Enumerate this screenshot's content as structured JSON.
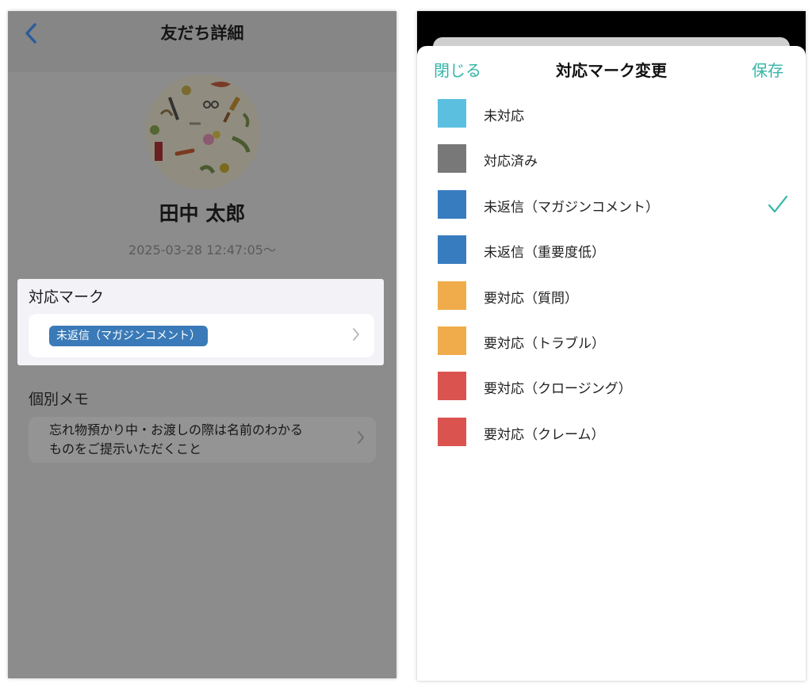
{
  "detail_screen": {
    "title": "友だち詳細",
    "user": {
      "name": "田中 太郎",
      "follow_date": "2025-03-28 12:47:05〜"
    },
    "mark_section": {
      "label": "対応マーク",
      "current_mark": "未返信（マガジンコメント）",
      "current_mark_color": "#3a7ab8"
    },
    "memo_section": {
      "label": "個別メモ",
      "text_line1": "忘れ物預かり中・お渡しの際は名前のわかる",
      "text_line2": "ものをご提示いただくこと"
    },
    "icons": {
      "back": "chevron-left-icon",
      "row_arrow": "chevron-right-icon"
    }
  },
  "mark_sheet": {
    "title": "対応マーク変更",
    "close_label": "閉じる",
    "save_label": "保存",
    "accent_color": "#35b6a8",
    "options": [
      {
        "label": "未対応",
        "color": "#5bbfdf",
        "selected": false
      },
      {
        "label": "対応済み",
        "color": "#787878",
        "selected": false
      },
      {
        "label": "未返信（マガジンコメント）",
        "color": "#377cbf",
        "selected": true
      },
      {
        "label": "未返信（重要度低）",
        "color": "#377cbf",
        "selected": false
      },
      {
        "label": "要対応（質問）",
        "color": "#f0ac4a",
        "selected": false
      },
      {
        "label": "要対応（トラブル）",
        "color": "#f0ac4a",
        "selected": false
      },
      {
        "label": "要対応（クロージング）",
        "color": "#da534f",
        "selected": false
      },
      {
        "label": "要対応（クレーム）",
        "color": "#da534f",
        "selected": false
      }
    ]
  }
}
